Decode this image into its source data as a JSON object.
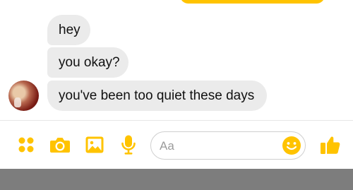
{
  "colors": {
    "accent": "#ffc300",
    "incoming_bubble": "#ebebeb",
    "nav_bar": "#7d7d7d"
  },
  "messages": [
    {
      "text": "hey"
    },
    {
      "text": "you okay?"
    },
    {
      "text": "you've been too quiet these days"
    }
  ],
  "composer": {
    "placeholder": "Aa",
    "icons": [
      "grid-dots-icon",
      "camera-icon",
      "image-icon",
      "microphone-icon",
      "smiley-icon",
      "thumbs-up-icon"
    ]
  }
}
